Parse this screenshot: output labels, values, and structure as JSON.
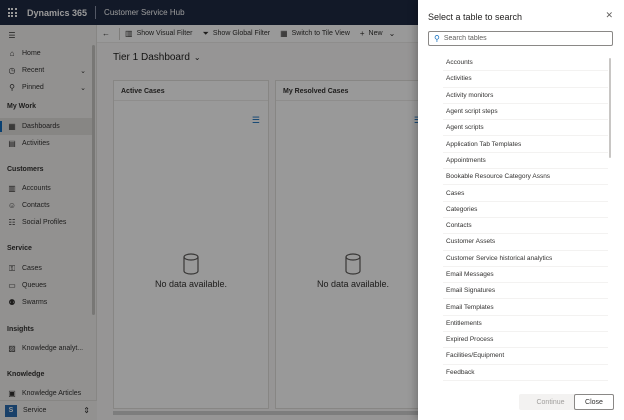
{
  "topbar": {
    "brand": "Dynamics 365",
    "app_name": "Customer Service Hub"
  },
  "sidebar": {
    "top_items": [
      {
        "label": "Home",
        "icon": "home-icon"
      },
      {
        "label": "Recent",
        "icon": "clock-icon"
      },
      {
        "label": "Pinned",
        "icon": "pin-icon"
      }
    ],
    "groups": [
      {
        "title": "My Work",
        "items": [
          {
            "label": "Dashboards",
            "icon": "dashboard-icon"
          },
          {
            "label": "Activities",
            "icon": "activities-icon"
          }
        ]
      },
      {
        "title": "Customers",
        "items": [
          {
            "label": "Accounts",
            "icon": "accounts-icon"
          },
          {
            "label": "Contacts",
            "icon": "contacts-icon"
          },
          {
            "label": "Social Profiles",
            "icon": "social-profiles-icon"
          }
        ]
      },
      {
        "title": "Service",
        "items": [
          {
            "label": "Cases",
            "icon": "cases-icon"
          },
          {
            "label": "Queues",
            "icon": "queues-icon"
          },
          {
            "label": "Swarms",
            "icon": "swarms-icon"
          }
        ]
      },
      {
        "title": "Insights",
        "items": [
          {
            "label": "Knowledge analyt...",
            "icon": "analytics-icon"
          }
        ]
      },
      {
        "title": "Knowledge",
        "items": [
          {
            "label": "Knowledge Articles",
            "icon": "knowledge-icon"
          }
        ]
      }
    ],
    "area": {
      "badge": "S",
      "label": "Service"
    }
  },
  "commandbar": {
    "show_visual_filter": "Show Visual Filter",
    "show_global_filter": "Show Global Filter",
    "switch_tile_view": "Switch to Tile View",
    "new": "New"
  },
  "dashboard": {
    "title": "Tier 1 Dashboard",
    "cards": [
      {
        "title": "Active Cases",
        "empty_text": "No data available."
      },
      {
        "title": "My Resolved Cases",
        "empty_text": "No data available."
      }
    ]
  },
  "panel": {
    "title": "Select a table to search",
    "search_placeholder": "Search tables",
    "tables": [
      "Accounts",
      "Activities",
      "Activity monitors",
      "Agent script steps",
      "Agent scripts",
      "Application Tab Templates",
      "Appointments",
      "Bookable Resource Category Assns",
      "Cases",
      "Categories",
      "Contacts",
      "Customer Assets",
      "Customer Service historical analytics",
      "Email Messages",
      "Email Signatures",
      "Email Templates",
      "Entitlements",
      "Expired Process",
      "Facilities/Equipment",
      "Feedback"
    ],
    "continue_label": "Continue",
    "close_label": "Close"
  }
}
